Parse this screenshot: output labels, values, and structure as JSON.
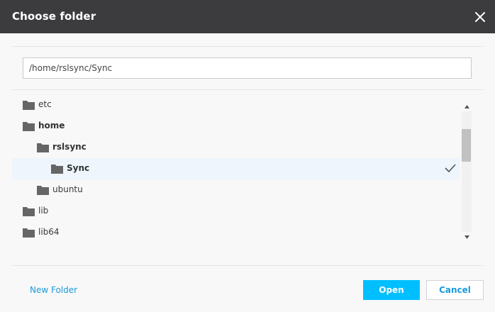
{
  "dialog": {
    "title": "Choose folder",
    "close_icon": "close-icon"
  },
  "path": {
    "value": "/home/rslsync/Sync"
  },
  "tree": {
    "items": [
      {
        "label": "etc",
        "depth": 0,
        "expanded": false,
        "selected": false,
        "bold": false
      },
      {
        "label": "home",
        "depth": 1,
        "expanded": true,
        "selected": false,
        "bold": true
      },
      {
        "label": "rslsync",
        "depth": 2,
        "expanded": true,
        "selected": false,
        "bold": true
      },
      {
        "label": "Sync",
        "depth": 3,
        "expanded": false,
        "selected": true,
        "bold": true
      },
      {
        "label": "ubuntu",
        "depth": 2,
        "expanded": false,
        "selected": false,
        "bold": false
      },
      {
        "label": "lib",
        "depth": 0,
        "expanded": false,
        "selected": false,
        "bold": false
      },
      {
        "label": "lib64",
        "depth": 0,
        "expanded": false,
        "selected": false,
        "bold": false
      }
    ],
    "folder_icon": "folder-icon",
    "check_icon": "checkmark-icon"
  },
  "footer": {
    "new_folder_label": "New Folder",
    "open_label": "Open",
    "cancel_label": "Cancel"
  },
  "colors": {
    "titlebar": "#3c3c3e",
    "accent": "#00bfff",
    "link": "#1a9ad7",
    "selected_row": "#eef5fc"
  }
}
